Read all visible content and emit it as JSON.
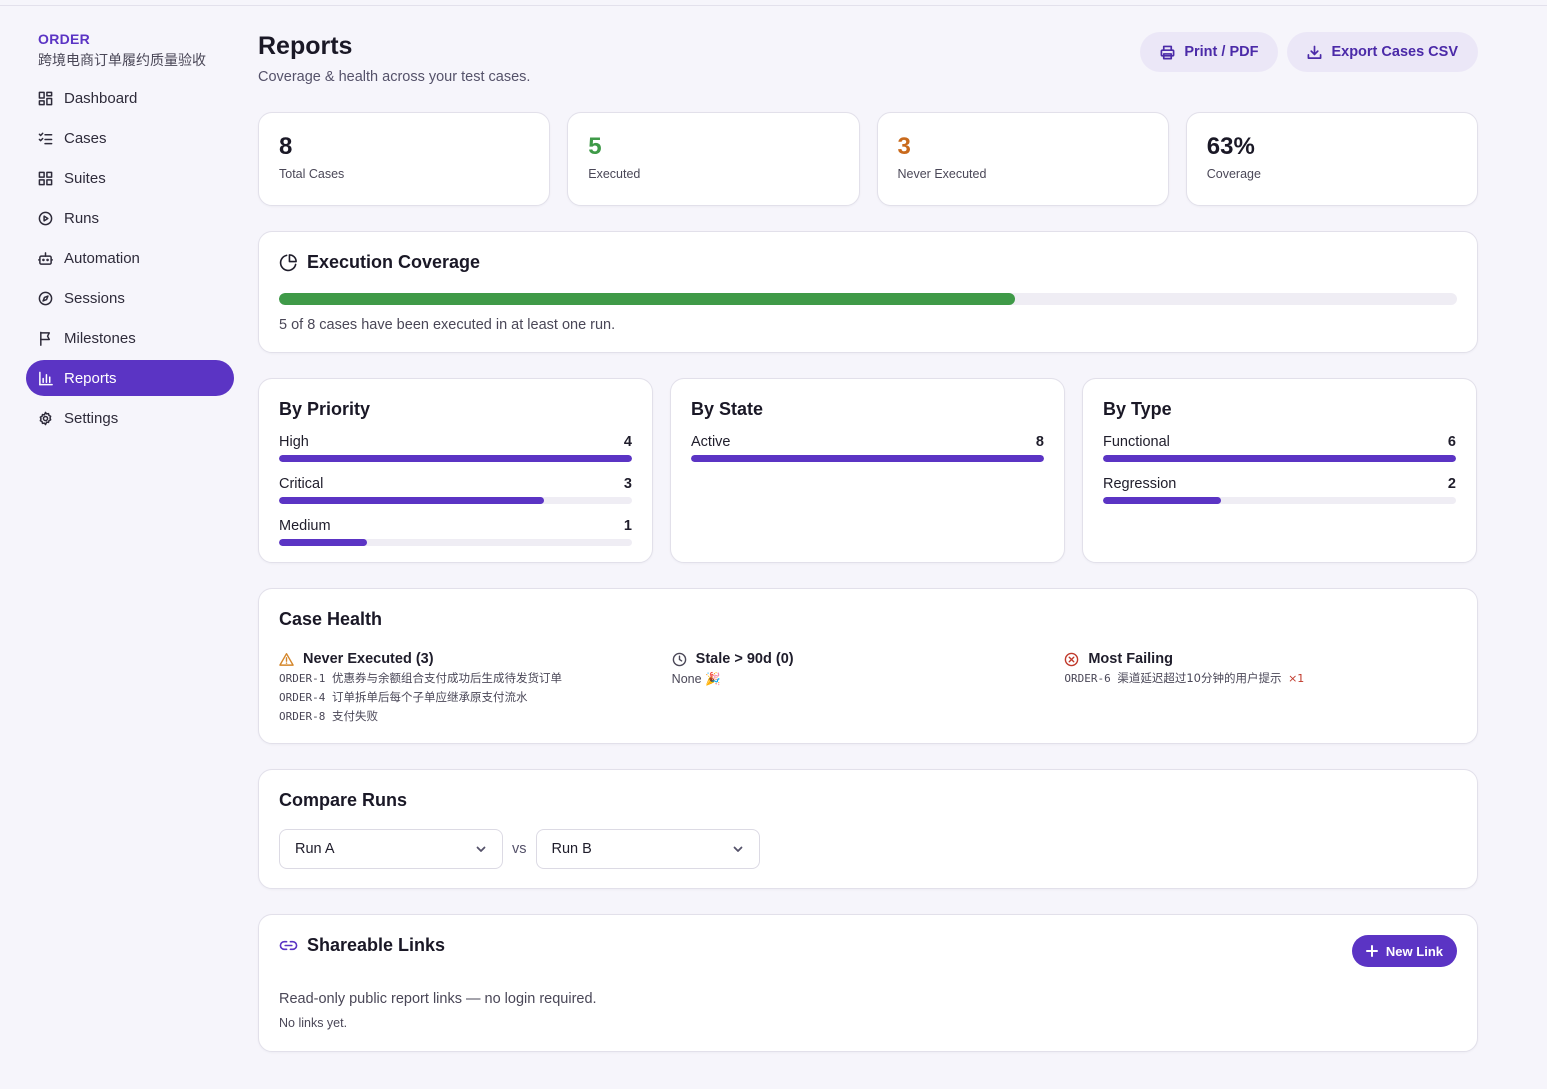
{
  "sidebar": {
    "project_key": "ORDER",
    "project_name": "跨境电商订单履约质量验收",
    "items": [
      {
        "label": "Dashboard",
        "icon": "dashboard-icon"
      },
      {
        "label": "Cases",
        "icon": "checklist-icon"
      },
      {
        "label": "Suites",
        "icon": "grid-icon"
      },
      {
        "label": "Runs",
        "icon": "play-circle-icon"
      },
      {
        "label": "Automation",
        "icon": "robot-icon"
      },
      {
        "label": "Sessions",
        "icon": "compass-icon"
      },
      {
        "label": "Milestones",
        "icon": "flag-icon"
      },
      {
        "label": "Reports",
        "icon": "bar-chart-icon",
        "active": true
      },
      {
        "label": "Settings",
        "icon": "gear-icon"
      }
    ]
  },
  "header": {
    "title": "Reports",
    "subtitle": "Coverage & health across your test cases.",
    "print_label": "Print / PDF",
    "export_label": "Export Cases CSV"
  },
  "stats": [
    {
      "value": "8",
      "label": "Total Cases",
      "color": "#1a1826"
    },
    {
      "value": "5",
      "label": "Executed",
      "color": "#3f9a48"
    },
    {
      "value": "3",
      "label": "Never Executed",
      "color": "#c96a1c"
    },
    {
      "value": "63%",
      "label": "Coverage",
      "color": "#1a1826"
    }
  ],
  "coverage": {
    "title": "Execution Coverage",
    "executed": 5,
    "total": 8,
    "progress_fraction": 0.625,
    "text": "5 of 8 cases have been executed in at least one run."
  },
  "breakdown": {
    "priority": {
      "title": "By Priority",
      "max": 4,
      "rows": [
        {
          "label": "High",
          "count": "4",
          "value": 4
        },
        {
          "label": "Critical",
          "count": "3",
          "value": 3
        },
        {
          "label": "Medium",
          "count": "1",
          "value": 1
        }
      ]
    },
    "state": {
      "title": "By State",
      "max": 8,
      "rows": [
        {
          "label": "Active",
          "count": "8",
          "value": 8
        }
      ]
    },
    "type": {
      "title": "By Type",
      "max": 6,
      "rows": [
        {
          "label": "Functional",
          "count": "6",
          "value": 6
        },
        {
          "label": "Regression",
          "count": "2",
          "value": 2
        }
      ]
    }
  },
  "health": {
    "title": "Case Health",
    "never_executed": {
      "title": "Never Executed (3)",
      "items": [
        {
          "id": "ORDER-1",
          "name": "优惠券与余额组合支付成功后生成待发货订单"
        },
        {
          "id": "ORDER-4",
          "name": "订单拆单后每个子单应继承原支付流水"
        },
        {
          "id": "ORDER-8",
          "name": "支付失败"
        }
      ]
    },
    "stale": {
      "title": "Stale > 90d (0)",
      "none_text": "None 🎉"
    },
    "most_failing": {
      "title": "Most Failing",
      "items": [
        {
          "id": "ORDER-6",
          "name": "渠道延迟超过10分钟的用户提示",
          "count": "×1"
        }
      ]
    }
  },
  "compare": {
    "title": "Compare Runs",
    "run_a": "Run A",
    "vs": "vs",
    "run_b": "Run B"
  },
  "links": {
    "title": "Shareable Links",
    "new_label": "New Link",
    "description": "Read-only public report links — no login required.",
    "empty": "No links yet."
  }
}
